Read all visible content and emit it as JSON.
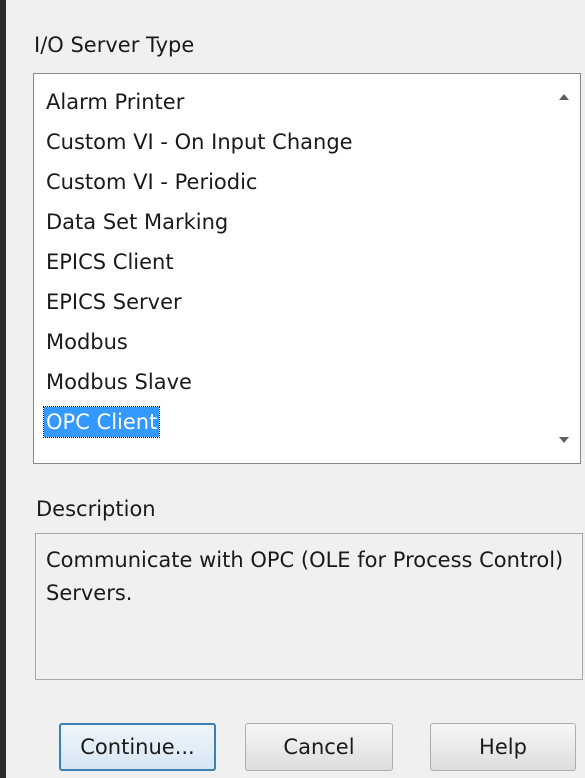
{
  "server_type": {
    "label": "I/O Server Type",
    "items": [
      "Alarm Printer",
      "Custom VI - On Input Change",
      "Custom VI - Periodic",
      "Data Set Marking",
      "EPICS Client",
      "EPICS Server",
      "Modbus",
      "Modbus Slave",
      "OPC Client"
    ],
    "selected": "OPC Client"
  },
  "description": {
    "label": "Description",
    "text": "Communicate with OPC (OLE for Process Control) Servers."
  },
  "buttons": {
    "continue_label": "Continue...",
    "cancel_label": "Cancel",
    "help_label": "Help"
  },
  "colors": {
    "selection": "#3399ff",
    "default_button_border": "#3c7fb1"
  }
}
